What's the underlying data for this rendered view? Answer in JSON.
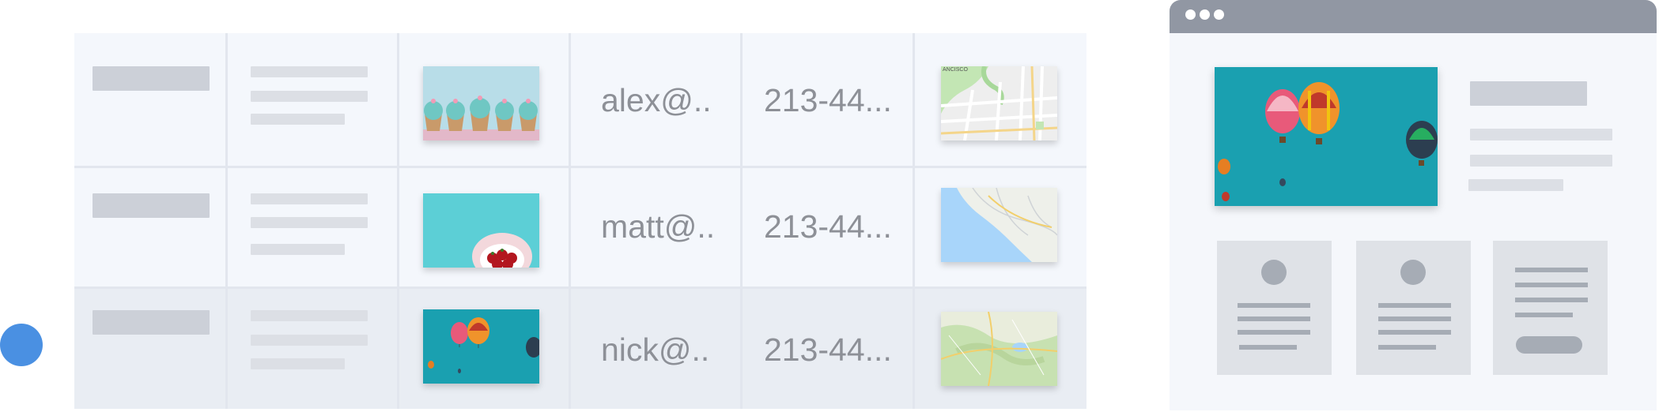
{
  "table": {
    "rows": [
      {
        "email": "alex@..",
        "phone": "213-44...",
        "photo_icon": "cupcakes-photo",
        "map_icon": "city-map-thumbnail"
      },
      {
        "email": "matt@..",
        "phone": "213-44...",
        "photo_icon": "strawberries-photo",
        "map_icon": "coast-map-thumbnail"
      },
      {
        "email": "nick@..",
        "phone": "213-44...",
        "photo_icon": "balloons-photo",
        "map_icon": "terrain-map-thumbnail"
      }
    ],
    "map_label": "ANCISCO",
    "highlighted_row": 2
  },
  "colors": {
    "accent": "#4a90e2",
    "table_bg": "#f4f7fc",
    "row_highlight": "#e9edf3",
    "placeholder": "#dcdfe5",
    "window_bar": "#9197a3"
  },
  "window": {
    "hero_icon": "balloons-photo"
  }
}
